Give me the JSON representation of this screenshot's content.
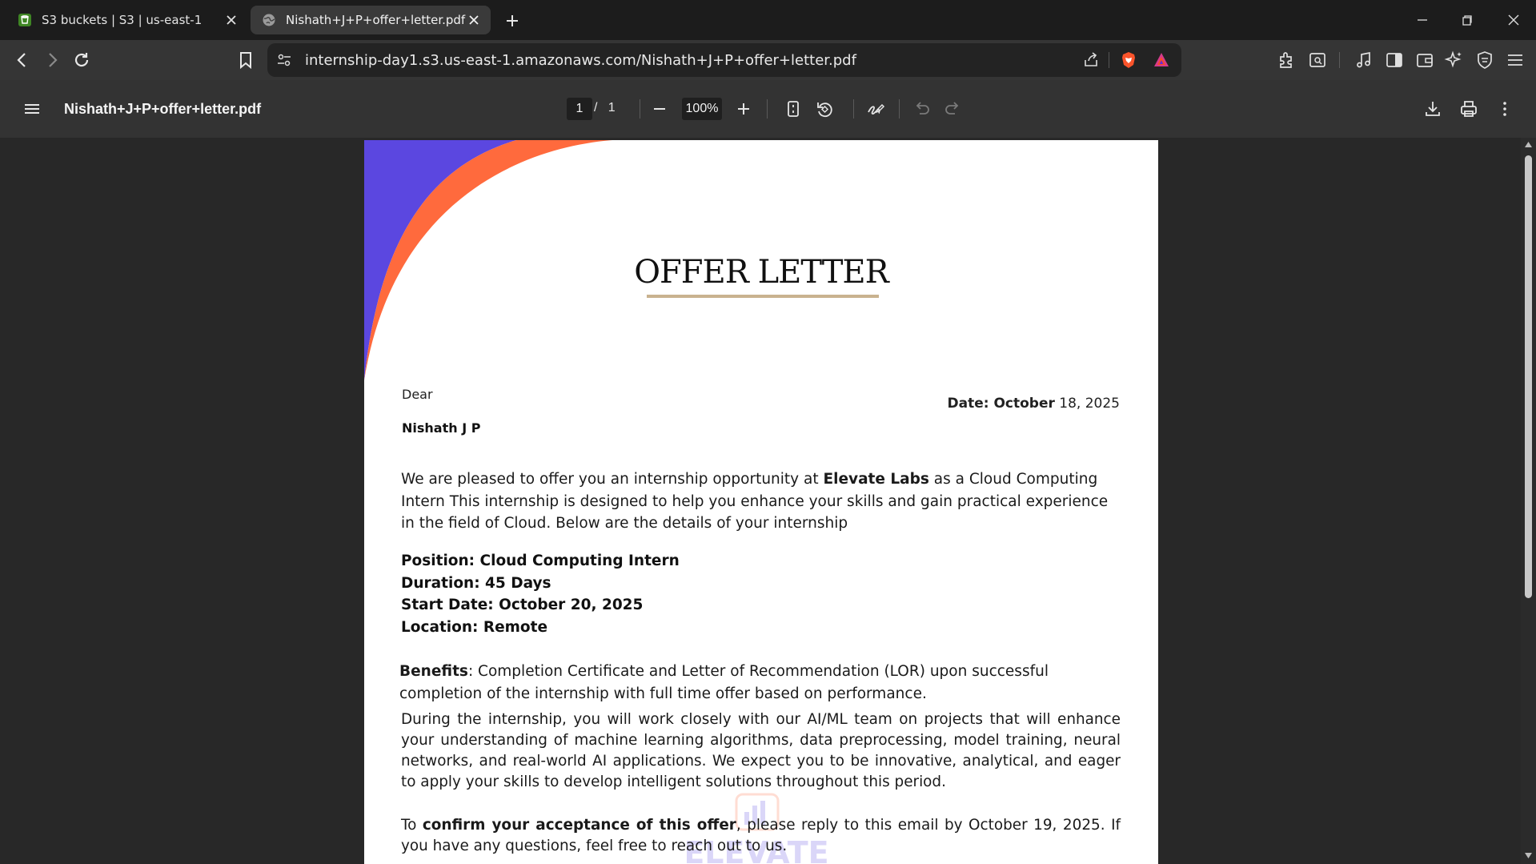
{
  "tabs": [
    {
      "title": "S3 buckets | S3 | us-east-1",
      "active": false
    },
    {
      "title": "Nishath+J+P+offer+letter.pdf",
      "active": true
    }
  ],
  "address_bar": {
    "url": "internship-day1.s3.us-east-1.amazonaws.com/Nishath+J+P+offer+letter.pdf"
  },
  "pdf_toolbar": {
    "file_name": "Nishath+J+P+offer+letter.pdf",
    "current_page": "1",
    "page_separator": "/",
    "total_pages": "1",
    "zoom": "100%"
  },
  "document": {
    "title": "OFFER LETTER",
    "salutation": "Dear",
    "recipient": "Nishath J P",
    "date_label": "Date: October",
    "date_value": " 18, 2025",
    "intro_part1": "We are pleased to offer you an internship opportunity at ",
    "company": "Elevate Labs",
    "intro_part2": " as a Cloud Computing Intern This internship is designed to help you enhance your skills and gain practical experience in the field of Cloud. Below are the details of your internship",
    "details": [
      "Position: Cloud Computing Intern",
      "Duration: 45 Days",
      "Start Date: October 20, 2025",
      "Location: Remote"
    ],
    "benefits_label": "Benefits",
    "benefits_text": ": Completion Certificate and Letter of Recommendation (LOR) upon successful completion of the internship with full time offer based on performance.",
    "work_paragraph": "During the internship, you will work closely with our AI/ML team on projects that will enhance your understanding of machine learning algorithms, data preprocessing, model training, neural networks, and real-world AI applications. We expect you to be innovative, analytical, and eager to apply your skills to develop intelligent solutions throughout this period.",
    "confirm_prefix": "To ",
    "confirm_bold": "confirm your acceptance of this offer",
    "confirm_suffix": ", please reply to this email by October 19, 2025. If you have any questions, feel free to reach out to us.",
    "watermark_text": "ELEVATE"
  },
  "colors": {
    "accent_purple": "#5b47e0",
    "accent_orange": "#ff6a3d",
    "title_underline": "#c9b28f",
    "brave_orange": "#fb542b"
  }
}
